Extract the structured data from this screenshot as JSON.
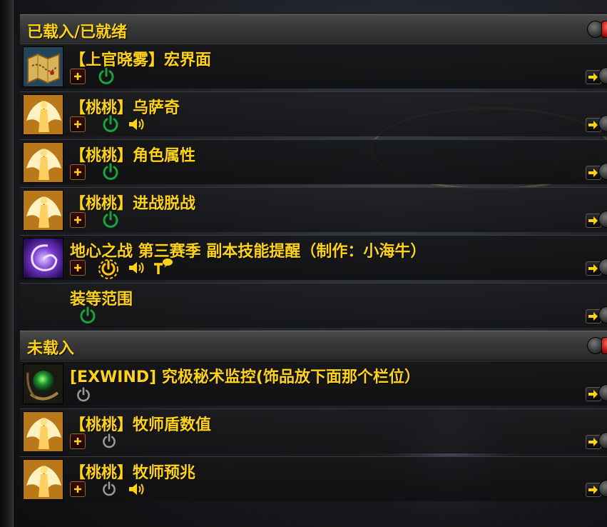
{
  "sections": [
    {
      "title": "已载入/已就绪",
      "rows": [
        {
          "name": "【上官晓雾】宏界面",
          "icon": "treasure-map-icon",
          "power_state": "on",
          "has_plus": true,
          "has_sound": false,
          "has_text": false
        },
        {
          "name": "【桃桃】乌萨奇",
          "icon": "angel-wings-icon",
          "power_state": "on",
          "has_plus": true,
          "has_sound": true,
          "has_text": false
        },
        {
          "name": "【桃桃】角色属性",
          "icon": "angel-wings-icon",
          "power_state": "on",
          "has_plus": true,
          "has_sound": false,
          "has_text": false
        },
        {
          "name": "【桃桃】进战脱战",
          "icon": "angel-wings-icon",
          "power_state": "on",
          "has_plus": true,
          "has_sound": false,
          "has_text": false
        },
        {
          "name": "地心之战 第三赛季 副本技能提醒（制作：小海牛）",
          "icon": "purple-vortex-icon",
          "power_state": "loading",
          "has_plus": true,
          "has_sound": true,
          "has_text": true
        },
        {
          "name": "装等范围",
          "icon": "none",
          "power_state": "on",
          "has_plus": false,
          "has_sound": false,
          "has_text": false
        }
      ]
    },
    {
      "title": "未载入",
      "rows": [
        {
          "name": "[EXWIND] 究极秘术监控(饰品放下面那个栏位）",
          "icon": "green-orb-icon",
          "power_state": "off",
          "has_plus": false,
          "has_sound": false,
          "has_text": false
        },
        {
          "name": "【桃桃】牧师盾数值",
          "icon": "angel-wings-icon",
          "power_state": "off",
          "has_plus": true,
          "has_sound": false,
          "has_text": false
        },
        {
          "name": "【桃桃】牧师预兆",
          "icon": "angel-wings-icon",
          "power_state": "off",
          "has_plus": true,
          "has_sound": true,
          "has_text": false
        }
      ]
    }
  ],
  "colors": {
    "title_yellow": "#ffd21a",
    "power_on": "#1aa33a",
    "power_off": "#9a9a9a",
    "power_loading": "#ffc21a"
  }
}
